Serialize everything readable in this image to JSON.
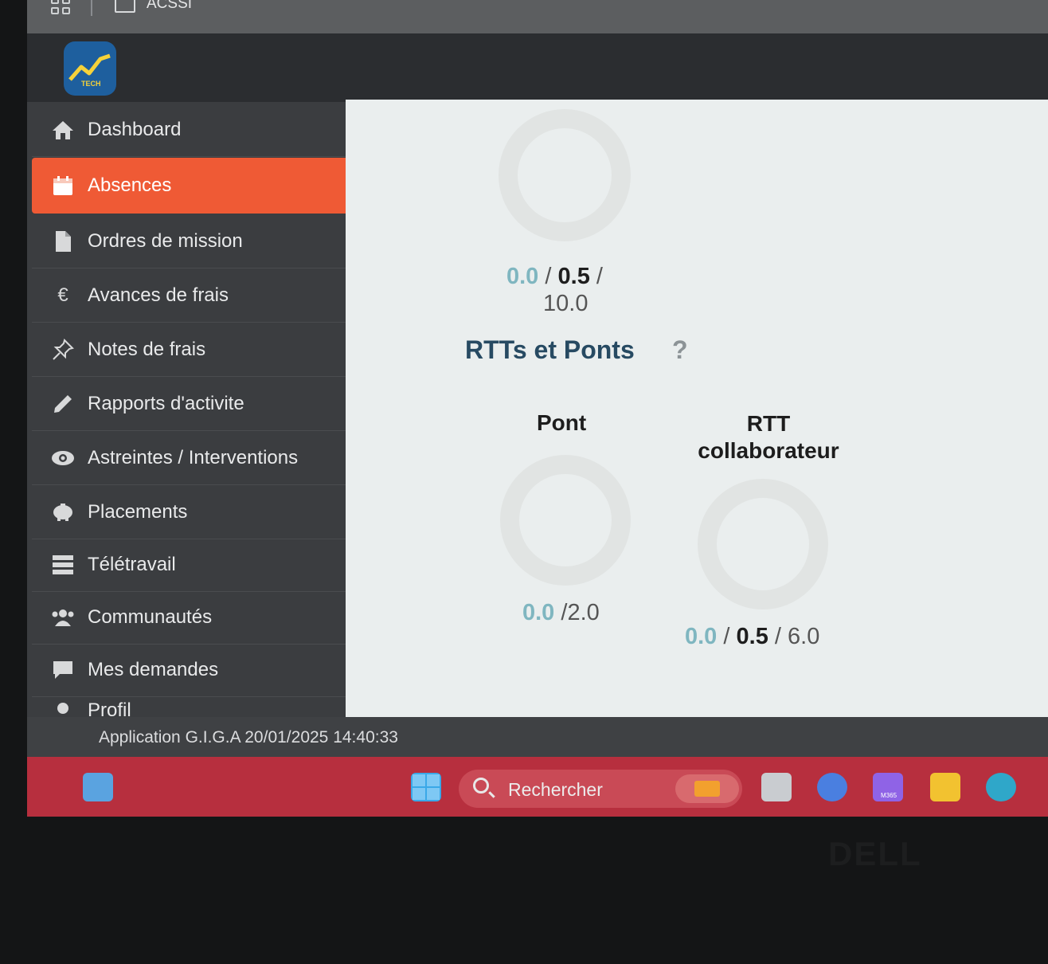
{
  "browser": {
    "tab_title": "ACSSI"
  },
  "brand": {
    "logo_text": "TECH"
  },
  "sidebar": {
    "items": [
      {
        "label": "Dashboard",
        "icon": "home-icon"
      },
      {
        "label": "Absences",
        "icon": "calendar-icon",
        "active": true
      },
      {
        "label": "Ordres de mission",
        "icon": "file-icon"
      },
      {
        "label": "Avances de frais",
        "icon": "euro-icon"
      },
      {
        "label": "Notes de frais",
        "icon": "pin-icon"
      },
      {
        "label": "Rapports d'activite",
        "icon": "pencil-icon"
      },
      {
        "label": "Astreintes / Interventions",
        "icon": "eye-icon"
      },
      {
        "label": "Placements",
        "icon": "piggy-bank-icon"
      },
      {
        "label": "Télétravail",
        "icon": "server-icon"
      },
      {
        "label": "Communautés",
        "icon": "users-icon"
      },
      {
        "label": "Mes demandes",
        "icon": "comment-icon"
      },
      {
        "label": "Profil",
        "icon": "user-icon"
      }
    ],
    "active_color": "#ef5a35"
  },
  "main": {
    "top_balance": {
      "taken": "0.0",
      "planned": "0.5",
      "total": "10.0"
    },
    "section_title": "RTTs et Ponts",
    "help_symbol": "?",
    "pont": {
      "title": "Pont",
      "taken": "0.0",
      "total": "2.0"
    },
    "rtt": {
      "title_line1": "RTT",
      "title_line2": "collaborateur",
      "taken": "0.0",
      "planned": "0.5",
      "total": "6.0"
    }
  },
  "status": {
    "text": "Application G.I.G.A 20/01/2025 14:40:33"
  },
  "taskbar": {
    "search_placeholder": "Rechercher",
    "m365_label": "M365"
  },
  "device": {
    "brand": "DELL"
  }
}
